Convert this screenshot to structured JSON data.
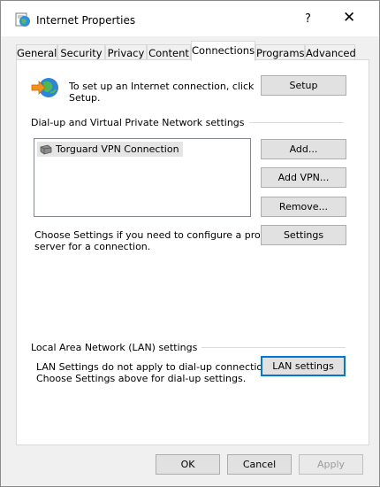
{
  "window": {
    "title": "Internet Properties",
    "help_label": "?",
    "close_label": "✕"
  },
  "tabs": [
    {
      "label": "General"
    },
    {
      "label": "Security"
    },
    {
      "label": "Privacy"
    },
    {
      "label": "Content"
    },
    {
      "label": "Connections",
      "active": true
    },
    {
      "label": "Programs"
    },
    {
      "label": "Advanced"
    }
  ],
  "connections": {
    "setup_text_line1": "To set up an Internet connection, click",
    "setup_text_line2": "Setup.",
    "setup_button": "Setup",
    "dialup_group_label": "Dial-up and Virtual Private Network settings",
    "connections_list": [
      {
        "name": "Torguard VPN Connection",
        "icon": "vpn-connection-icon"
      }
    ],
    "add_button": "Add...",
    "add_vpn_button": "Add VPN...",
    "remove_button": "Remove...",
    "settings_hint_line1": "Choose Settings if you need to configure a proxy",
    "settings_hint_line2": "server for a connection.",
    "settings_button": "Settings",
    "lan_group_label": "Local Area Network (LAN) settings",
    "lan_hint_line1": "LAN Settings do not apply to dial-up connections.",
    "lan_hint_line2": "Choose Settings above for dial-up settings.",
    "lan_settings_button": "LAN settings"
  },
  "footer": {
    "ok_button": "OK",
    "cancel_button": "Cancel",
    "apply_button": "Apply"
  },
  "colors": {
    "accent": "#0078d7",
    "button_face": "#e1e1e1",
    "dialog_bg": "#f0f0f0"
  }
}
